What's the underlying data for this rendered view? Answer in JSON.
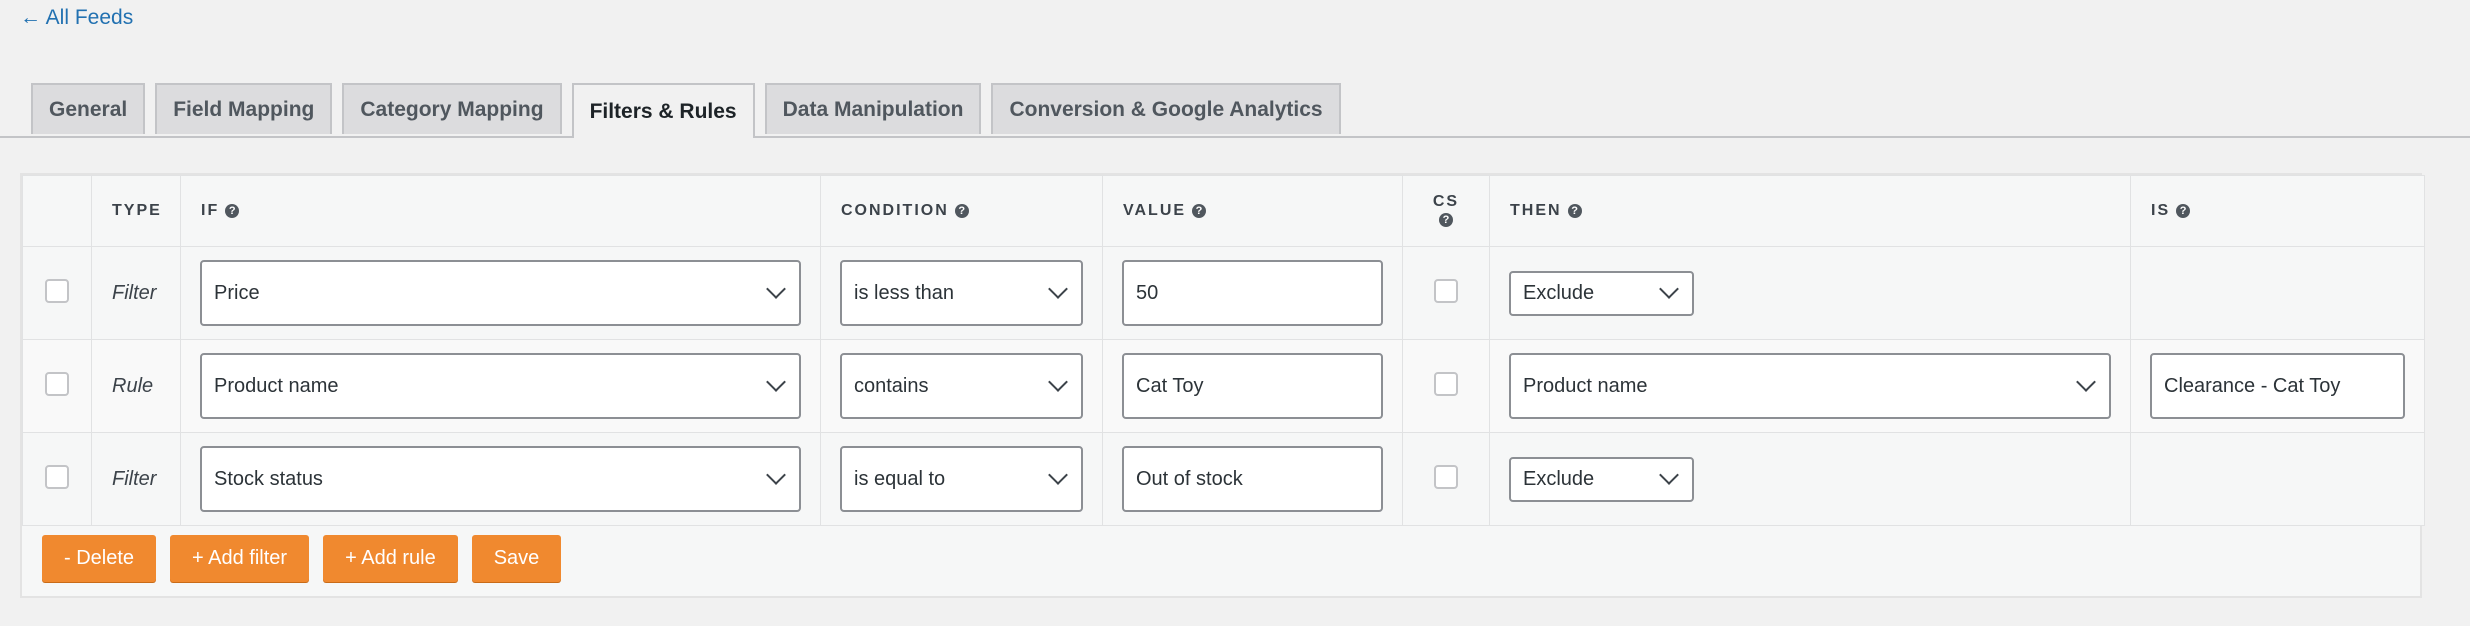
{
  "back_link": "← All Feeds",
  "tabs": [
    {
      "label": "General",
      "active": false
    },
    {
      "label": "Field Mapping",
      "active": false
    },
    {
      "label": "Category Mapping",
      "active": false
    },
    {
      "label": "Filters & Rules",
      "active": true
    },
    {
      "label": "Data Manipulation",
      "active": false
    },
    {
      "label": "Conversion & Google Analytics",
      "active": false
    }
  ],
  "table": {
    "headers": {
      "type": "TYPE",
      "if": "IF",
      "condition": "CONDITION",
      "value": "VALUE",
      "cs": "CS",
      "then": "THEN",
      "is": "IS"
    },
    "help_glyph": "?",
    "rows": [
      {
        "type": "Filter",
        "if": "Price",
        "condition": "is less than",
        "value": "50",
        "then": "Exclude",
        "is": ""
      },
      {
        "type": "Rule",
        "if": "Product name",
        "condition": "contains",
        "value": "Cat Toy",
        "then": "Product name",
        "is": "Clearance - Cat Toy"
      },
      {
        "type": "Filter",
        "if": "Stock status",
        "condition": "is equal to",
        "value": "Out of stock",
        "then": "Exclude",
        "is": ""
      }
    ]
  },
  "actions": {
    "delete": "- Delete",
    "add_filter": "+ Add filter",
    "add_rule": "+ Add rule",
    "save": "Save"
  },
  "colors": {
    "accent": "#f0892f",
    "link": "#2271b1"
  },
  "icons": {
    "help": "question-circle-icon",
    "dropdown": "chevron-down-icon"
  }
}
